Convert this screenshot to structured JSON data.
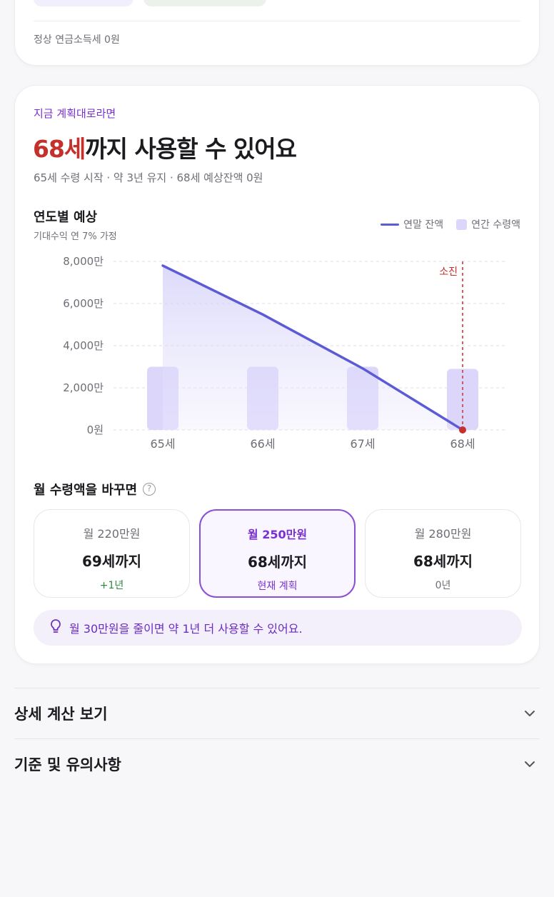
{
  "top_card": {
    "tax_note": "정상 연금소득세 0원"
  },
  "plan": {
    "eyebrow": "지금 계획대로라면",
    "headline_age": "68세",
    "headline_rest": "까지 사용할 수 있어요",
    "summary": "65세 수령 시작 · 약 3년 유지 · 68세 예상잔액 0원"
  },
  "chart_section": {
    "title": "연도별 예상",
    "subtitle": "기대수익 연 7% 가정",
    "legend_line": "연말 잔액",
    "legend_bar": "연간 수령액"
  },
  "chart_data": {
    "type": "bar",
    "categories": [
      "65세",
      "66세",
      "67세",
      "68세"
    ],
    "series": [
      {
        "name": "연말 잔액",
        "kind": "line-area",
        "values": [
          7800,
          5480,
          2920,
          0
        ],
        "color": "#5b5bd6"
      },
      {
        "name": "연간 수령액",
        "kind": "bar",
        "values": [
          3000,
          3000,
          3000,
          2900
        ],
        "color": "#dcd6fb"
      }
    ],
    "ylim": [
      0,
      8000
    ],
    "yticks": [
      0,
      2000,
      4000,
      6000,
      8000
    ],
    "ytick_labels": [
      "0원",
      "2,000만",
      "4,000만",
      "6,000만",
      "8,000만"
    ],
    "annotation": {
      "label": "소진",
      "category": "68세",
      "color": "#c4302b"
    },
    "grid": true,
    "legend_position": "top-right"
  },
  "options": {
    "title": "월 수령액을 바꾸면",
    "help_icon": "question-circle-icon",
    "items": [
      {
        "amount": "월 220만원",
        "age": "69세까지",
        "diff": "+1년"
      },
      {
        "amount": "월 250만원",
        "age": "68세까지",
        "diff": "현재 계획"
      },
      {
        "amount": "월 280만원",
        "age": "68세까지",
        "diff": "0년"
      }
    ]
  },
  "tip": {
    "icon": "lightbulb-icon",
    "text": "월 30만원을 줄이면 약 1년 더 사용할 수 있어요."
  },
  "accordions": [
    {
      "label": "상세 계산 보기",
      "icon": "chevron-down-icon"
    },
    {
      "label": "기준 및 유의사항",
      "icon": "chevron-down-icon"
    }
  ],
  "colors": {
    "accent": "#7a2fcf",
    "danger": "#c4302b",
    "positive": "#2f8a3b",
    "line": "#5b5bd6",
    "bar": "#dcd6fb"
  }
}
